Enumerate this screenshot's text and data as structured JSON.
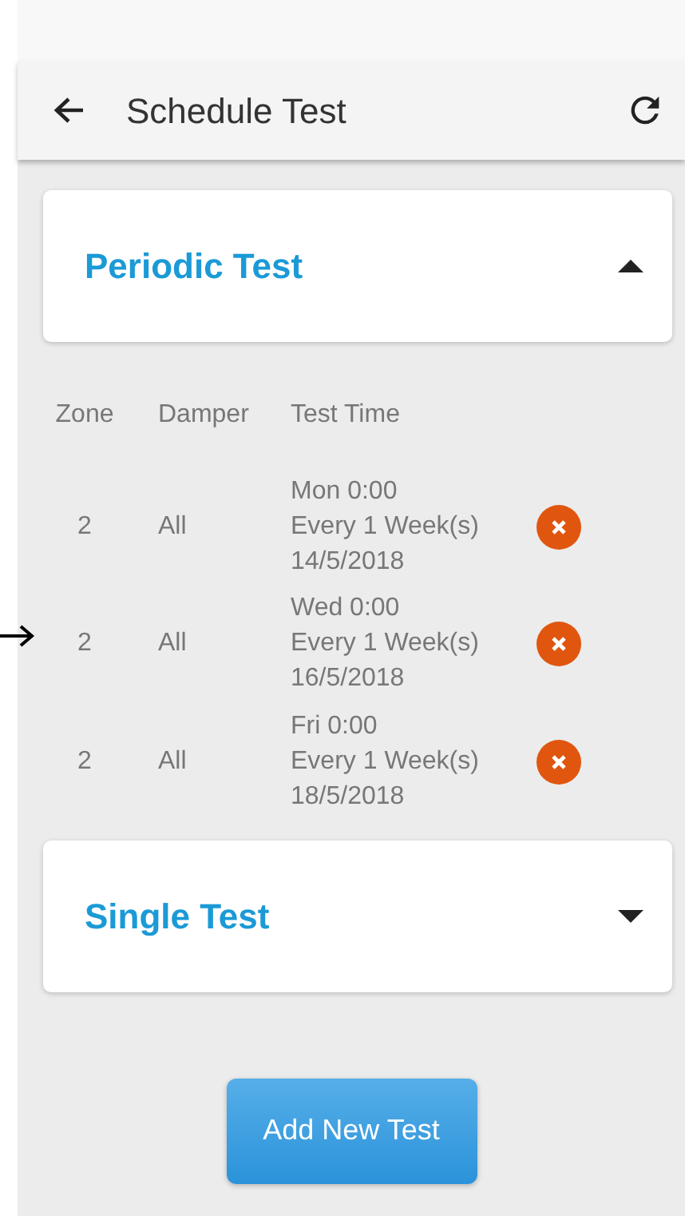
{
  "app_bar": {
    "title": "Schedule Test"
  },
  "sections": [
    {
      "title": "Periodic Test",
      "expanded": true,
      "table": {
        "columns": [
          "Zone",
          "Damper",
          "Test Time"
        ],
        "rows": [
          {
            "zone": "2",
            "damper": "All",
            "test_time": [
              "Mon 0:00",
              "Every 1 Week(s)",
              "14/5/2018"
            ]
          },
          {
            "zone": "2",
            "damper": "All",
            "test_time": [
              "Wed 0:00",
              "Every 1 Week(s)",
              "16/5/2018"
            ]
          },
          {
            "zone": "2",
            "damper": "All",
            "test_time": [
              "Fri 0:00",
              "Every 1 Week(s)",
              "18/5/2018"
            ]
          }
        ]
      }
    },
    {
      "title": "Single Test",
      "expanded": false
    }
  ],
  "button": {
    "label": "Add New Test"
  }
}
